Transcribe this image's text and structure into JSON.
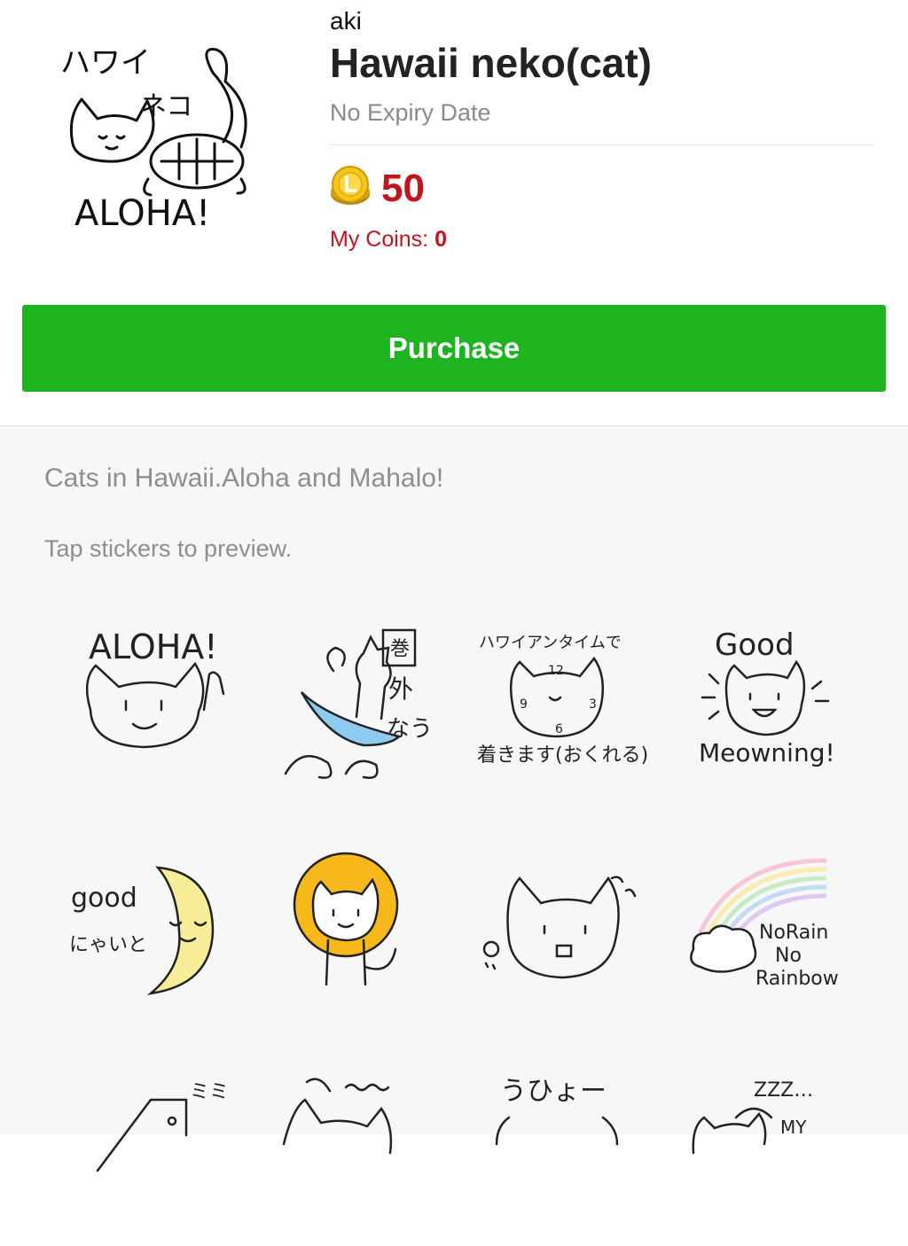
{
  "header": {
    "author": "aki",
    "title": "Hawaii neko(cat)",
    "expiry": "No Expiry Date",
    "price": "50",
    "my_coins_label": "My Coins:",
    "my_coins_value": "0",
    "coin_icon": "line-coin-icon",
    "image_alt_text": [
      "ハワイ",
      "ネコ",
      "ALOHA!"
    ]
  },
  "purchase_button": {
    "label": "Purchase",
    "color": "#1db420"
  },
  "description": "Cats in Hawaii.Aloha and Mahalo!",
  "hint": "Tap stickers to preview.",
  "colors": {
    "price_red": "#c3141c",
    "muted_text": "#8e8e8e",
    "background": "#f7f7f8"
  },
  "stickers": [
    {
      "name": "sticker-aloha",
      "texts": [
        "ALOHA!"
      ]
    },
    {
      "name": "sticker-surfing-cat",
      "texts": [
        "巻",
        "外",
        "なう"
      ]
    },
    {
      "name": "sticker-hawaiian-time",
      "texts": [
        "ハワイアンタイムで",
        "12",
        "9",
        "3",
        "6",
        "着きます(おくれる)"
      ]
    },
    {
      "name": "sticker-good-meowning",
      "texts": [
        "Good",
        "Meowning!"
      ]
    },
    {
      "name": "sticker-good-night-moon",
      "texts": [
        "good",
        "にゃいと"
      ]
    },
    {
      "name": "sticker-lion-cat",
      "texts": []
    },
    {
      "name": "sticker-surprised-cat",
      "texts": []
    },
    {
      "name": "sticker-no-rain-no-rainbow",
      "texts": [
        "NoRain",
        "No",
        "Rainbow"
      ]
    },
    {
      "name": "sticker-cat-box",
      "texts": [
        "ミミ"
      ]
    },
    {
      "name": "sticker-happy-cat",
      "texts": []
    },
    {
      "name": "sticker-uhyo",
      "texts": [
        "うひょー"
      ]
    },
    {
      "name": "sticker-sleeping-cat",
      "texts": [
        "ZZZ…",
        "MY"
      ]
    }
  ]
}
